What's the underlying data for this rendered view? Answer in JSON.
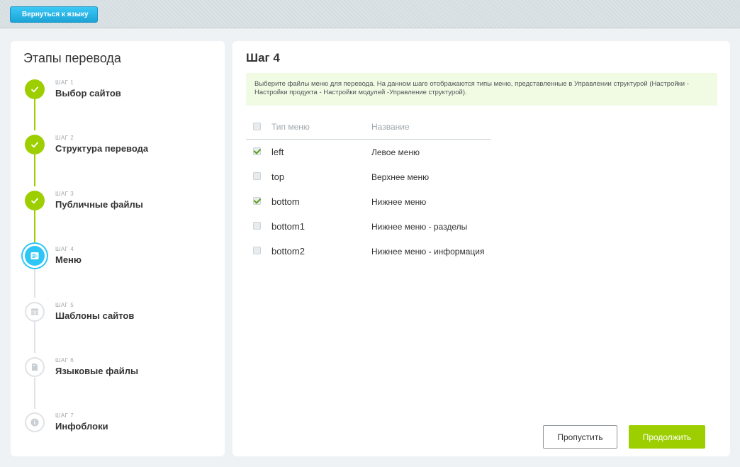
{
  "toolbar": {
    "back_label": "Вернуться к языку"
  },
  "steps_panel": {
    "title": "Этапы перевода",
    "steps": [
      {
        "num": "ШАГ 1",
        "name": "Выбор сайтов",
        "state": "done",
        "icon": "check-icon"
      },
      {
        "num": "ШАГ 2",
        "name": "Структура перевода",
        "state": "done",
        "icon": "check-icon"
      },
      {
        "num": "ШАГ 3",
        "name": "Публичные файлы",
        "state": "done",
        "icon": "check-icon"
      },
      {
        "num": "ШАГ 4",
        "name": "Меню",
        "state": "active",
        "icon": "menu-icon"
      },
      {
        "num": "ШАГ 5",
        "name": "Шаблоны сайтов",
        "state": "pending",
        "icon": "template-icon"
      },
      {
        "num": "ШАГ 6",
        "name": "Языковые файлы",
        "state": "pending",
        "icon": "file-icon"
      },
      {
        "num": "ШАГ 7",
        "name": "Инфоблоки",
        "state": "pending",
        "icon": "info-icon"
      }
    ]
  },
  "main": {
    "title": "Шаг 4",
    "notice": "Выберите файлы меню для перевода. На данном шаге отображаются типы меню, представленные в Управлении структурой (Настройки - Настройки продукта - Настройки модулей -Управление структурой).",
    "table": {
      "headers": {
        "type": "Тип меню",
        "name": "Название"
      },
      "rows": [
        {
          "type": "left",
          "name": "Левое меню",
          "checked": true
        },
        {
          "type": "top",
          "name": "Верхнее меню",
          "checked": false
        },
        {
          "type": "bottom",
          "name": "Нижнее меню",
          "checked": true
        },
        {
          "type": "bottom1",
          "name": "Нижнее меню - разделы",
          "checked": false
        },
        {
          "type": "bottom2",
          "name": "Нижнее меню - информация",
          "checked": false
        }
      ]
    },
    "buttons": {
      "skip": "Пропустить",
      "next": "Продолжить"
    }
  },
  "colors": {
    "accent_green": "#9dcf00",
    "accent_blue": "#2fc6f6",
    "notice_bg": "#f1fbe3"
  }
}
